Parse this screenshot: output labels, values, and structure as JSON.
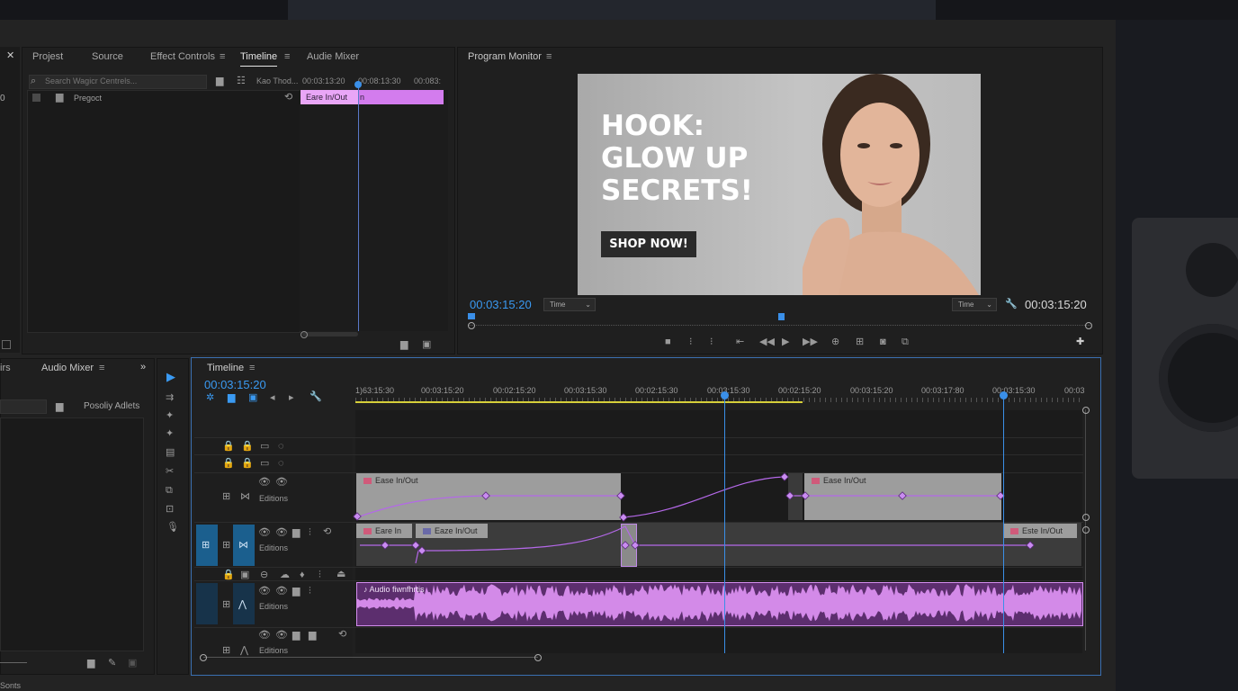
{
  "left_panel": {
    "tabs": [
      "Projest",
      "Source",
      "Effect Controls",
      "Timeline",
      "Audie Mixer"
    ],
    "active_tab": "Timeline",
    "search_placeholder": "Search Wagicr Centrels...",
    "tree_item": "Pregoct",
    "effect_header_label": "Kao Thod...",
    "ruler": [
      "00:03:13:20",
      "00:08:13:30",
      "00:083:"
    ],
    "clip_label": "Eare In/Out",
    "clip_suffix": "n"
  },
  "program_monitor": {
    "title": "Program Monitor",
    "headline_lines": [
      "HOOK:",
      "GLOW UP",
      "SECRETS!"
    ],
    "shop_button": "SHOP NOW!",
    "timecode_left": "00:03:15:20",
    "timecode_right": "00:03:15:20",
    "select_left": "Time",
    "select_right": "Time",
    "colors": {
      "accent": "#3a9af2",
      "photo_bg": "#b9b9b9"
    }
  },
  "bottom_left": {
    "tabs": [
      "irs",
      "Audio Mixer"
    ],
    "folder_label": "Posoliy Adlets",
    "status": "Sonts"
  },
  "timeline": {
    "title": "Timeline",
    "timecode": "00:03:15:20",
    "ruler": [
      "1)63:15:30",
      "00:03:15:20",
      "00:02:15:20",
      "00:03:15:30",
      "00:02:15:30",
      "00:03:15:30",
      "00:02:15:20",
      "00:03:15:20",
      "00:03:17:80",
      "00:03:15:30",
      "00:03"
    ],
    "tracks": [
      {
        "name": "Editions"
      },
      {
        "name": "Editions"
      },
      {
        "name": "Editions"
      },
      {
        "name": "Editions"
      }
    ],
    "clips": {
      "v1_a": "Ease In/Out",
      "v1_b": "Ease In/Out",
      "v2_a": "Eare In",
      "v2_b": "Eaze In/Out",
      "v2_c": "Este In/Out",
      "audio": "Audio fiwnfhrtis"
    },
    "colors": {
      "clip": "#9d9d9d",
      "keyframe": "#b468e8",
      "audio": "#cf7fe6",
      "playhead": "#3a8fe8",
      "track_target": "#1b5f8e"
    }
  }
}
